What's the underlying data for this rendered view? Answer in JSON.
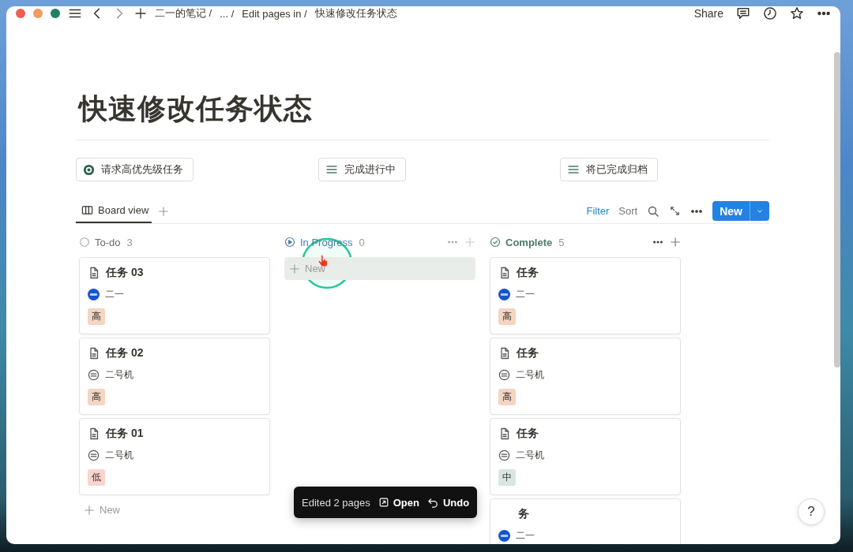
{
  "window": {
    "breadcrumbs": [
      "二一的笔记 /",
      "... /",
      "Edit pages in /",
      "快速修改任务状态"
    ],
    "share": "Share"
  },
  "page": {
    "title": "快速修改任务状态"
  },
  "buttons": [
    {
      "label": "请求高优先级任务"
    },
    {
      "label": "完成进行中"
    },
    {
      "label": "将已完成归档"
    }
  ],
  "views": {
    "tabs": [
      {
        "label": "Board view",
        "selected": true
      }
    ],
    "filter": "Filter",
    "sort": "Sort",
    "new": "New"
  },
  "columns": [
    {
      "name": "To-do",
      "count": "3",
      "actions": false,
      "new_label": "New",
      "new_hover": false,
      "cards": [
        {
          "title": "任务 03",
          "icon": true,
          "person": "二一",
          "kind": "photo",
          "tag": {
            "label": "高",
            "color": "#f3d5c2"
          }
        },
        {
          "title": "任务 02",
          "icon": true,
          "person": "二号机",
          "kind": "robot",
          "tag": {
            "label": "高",
            "color": "#f3d5c2"
          }
        },
        {
          "title": "任务 01",
          "icon": true,
          "person": "二号机",
          "kind": "robot",
          "tag": {
            "label": "低",
            "color": "#fad4cd"
          }
        }
      ]
    },
    {
      "name": "In Progress",
      "count": "0",
      "actions": true,
      "new_label": "New",
      "new_hover": true
    },
    {
      "name": "Complete",
      "count": "5",
      "actions": true,
      "cards": [
        {
          "title": "任务",
          "icon": true,
          "person": "二一",
          "kind": "photo",
          "tag": {
            "label": "高",
            "color": "#f3d5c2"
          }
        },
        {
          "title": "任务",
          "icon": true,
          "person": "二号机",
          "kind": "robot",
          "tag": {
            "label": "高",
            "color": "#f3d5c2"
          }
        },
        {
          "title": "任务",
          "icon": true,
          "person": "二号机",
          "kind": "robot",
          "tag": {
            "label": "中",
            "color": "#d8e6e0"
          }
        },
        {
          "title": "务",
          "icon": false,
          "person": "二一",
          "kind": "photo"
        }
      ]
    }
  ],
  "toast": {
    "text": "Edited 2 pages",
    "open": "Open",
    "undo": "Undo"
  },
  "help": "?"
}
